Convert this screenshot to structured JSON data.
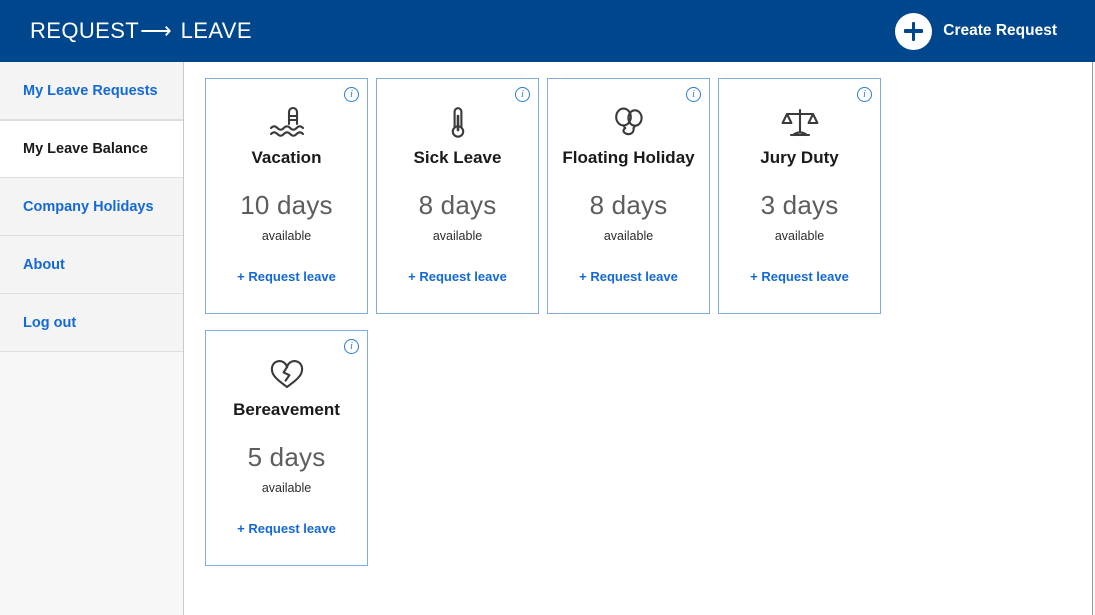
{
  "header": {
    "brand_prefix": "REQUEST",
    "brand_arrow": "⟶",
    "brand_suffix": "LEAVE",
    "create_request_label": "Create Request",
    "background_color": "#00468c",
    "text_color": "#ffffff"
  },
  "sidebar": {
    "items": [
      {
        "label": "My Leave Requests",
        "active": false
      },
      {
        "label": "My Leave Balance",
        "active": true
      },
      {
        "label": "Company Holidays",
        "active": false
      },
      {
        "label": "About",
        "active": false
      },
      {
        "label": "Log out",
        "active": false
      }
    ],
    "link_color": "#1569d6",
    "active_text_color": "#1a1a1a",
    "background_color": "#f4f4f4"
  },
  "main": {
    "card_border_color": "#7eadde",
    "amount_color": "#5d5d5d",
    "action_color": "#1569d6",
    "availability_label": "available",
    "action_label": "+ Request leave",
    "info_glyph": "i",
    "cards": [
      {
        "title": "Vacation",
        "amount": "10 days",
        "available": "available",
        "action": "+ Request leave",
        "icon": "swimming-pool-icon"
      },
      {
        "title": "Sick Leave",
        "amount": "8 days",
        "available": "available",
        "action": "+ Request leave",
        "icon": "thermometer-icon"
      },
      {
        "title": "Floating Holiday",
        "amount": "8 days",
        "available": "available",
        "action": "+ Request leave",
        "icon": "balloons-icon"
      },
      {
        "title": "Jury Duty",
        "amount": "3 days",
        "available": "available",
        "action": "+ Request leave",
        "icon": "scales-of-justice-icon"
      },
      {
        "title": "Bereavement",
        "amount": "5 days",
        "available": "available",
        "action": "+ Request leave",
        "icon": "broken-heart-icon"
      }
    ]
  }
}
